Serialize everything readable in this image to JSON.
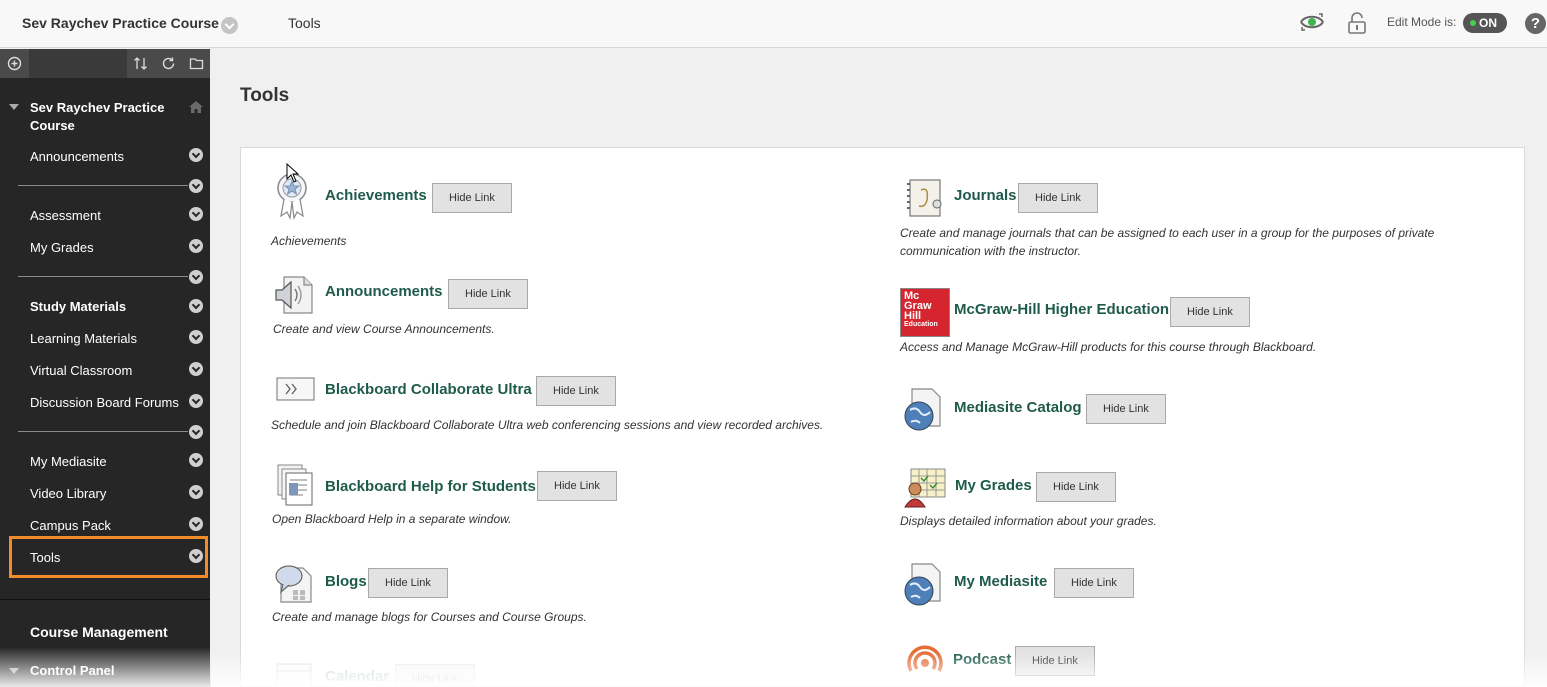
{
  "header": {
    "course_title": "Sev Raychev Practice Course",
    "breadcrumb": "Tools",
    "edit_mode_label": "Edit Mode is:",
    "edit_mode_value": "ON",
    "help_label": "?"
  },
  "sidebar": {
    "course_name": "Sev Raychev Practice Course",
    "items": [
      {
        "label": "Announcements"
      },
      {
        "label": "Assessment"
      },
      {
        "label": "My Grades"
      },
      {
        "label": "Study Materials"
      },
      {
        "label": "Learning Materials"
      },
      {
        "label": "Virtual Classroom"
      },
      {
        "label": "Discussion Board Forums"
      },
      {
        "label": "My Mediasite"
      },
      {
        "label": "Video Library"
      },
      {
        "label": "Campus Pack"
      },
      {
        "label": "Tools"
      }
    ],
    "course_management": "Course Management",
    "control_panel": "Control Panel"
  },
  "main": {
    "title": "Tools",
    "hide_link_label": "Hide Link",
    "tools": [
      {
        "name": "Achievements",
        "description": "Achievements"
      },
      {
        "name": "Announcements",
        "description": "Create and view Course Announcements."
      },
      {
        "name": "Blackboard Collaborate Ultra",
        "description": "Schedule and join Blackboard Collaborate Ultra web conferencing sessions and view recorded archives."
      },
      {
        "name": "Blackboard Help for Students",
        "description": "Open Blackboard Help in a separate window."
      },
      {
        "name": "Blogs",
        "description": "Create and manage blogs for Courses and Course Groups."
      },
      {
        "name": "Calendar",
        "description": ""
      },
      {
        "name": "Journals",
        "description_line1": "Create and manage journals that can be assigned to each user in a group for the purposes of private",
        "description_line2": "communication with the instructor."
      },
      {
        "name": "McGraw-Hill Higher Education",
        "description": "Access and Manage McGraw-Hill products for this course through Blackboard.",
        "logo_text": [
          "Mc",
          "Graw",
          "Hill",
          "Education"
        ]
      },
      {
        "name": "Mediasite Catalog",
        "description": ""
      },
      {
        "name": "My Grades",
        "description": "Displays detailed information about your grades."
      },
      {
        "name": "My Mediasite",
        "description": ""
      },
      {
        "name": "Podcast",
        "description": ""
      }
    ]
  }
}
